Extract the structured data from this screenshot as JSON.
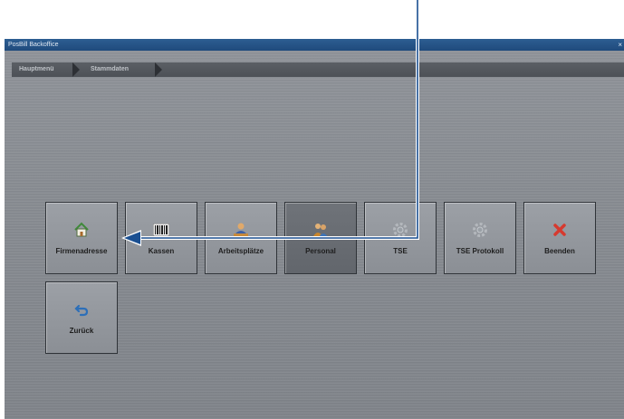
{
  "window": {
    "title": "PosBill Backoffice",
    "close_glyph": "×"
  },
  "breadcrumb": [
    {
      "label": "Hauptmenü"
    },
    {
      "label": "Stammdaten"
    }
  ],
  "tiles": [
    {
      "label": "Firmenadresse",
      "icon": "house-icon"
    },
    {
      "label": "Kassen",
      "icon": "barcode-icon"
    },
    {
      "label": "Arbeitsplätze",
      "icon": "workstation-icon"
    },
    {
      "label": "Personal",
      "icon": "people-icon"
    },
    {
      "label": "TSE",
      "icon": "gear-icon"
    },
    {
      "label": "TSE Protokoll",
      "icon": "gear-icon"
    },
    {
      "label": "Beenden",
      "icon": "close-icon"
    },
    {
      "label": "Zurück",
      "icon": "back-arrow-icon"
    }
  ],
  "colors": {
    "titlebar": "#1f4a7c",
    "tile_border": "#2f3338",
    "annotation_arrow": "#1a4f91",
    "close_red": "#d63a2f",
    "back_blue": "#2d6fb8"
  }
}
